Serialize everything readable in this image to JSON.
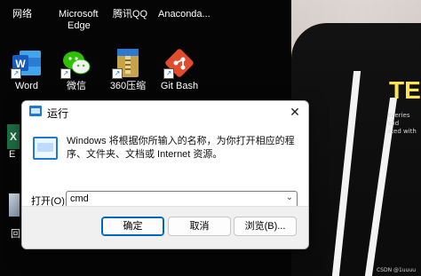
{
  "desktop": {
    "icons": [
      {
        "label": "网络",
        "icon": "network-icon"
      },
      {
        "label": "Microsoft Edge",
        "line1": "Microsoft",
        "line2": "Edge",
        "icon": "edge-icon"
      },
      {
        "label": "腾讯QQ",
        "icon": "qq-icon"
      },
      {
        "label": "Anaconda...",
        "icon": "anaconda-icon"
      },
      {
        "label": "Word",
        "icon": "word-icon"
      },
      {
        "label": "微信",
        "icon": "wechat-icon"
      },
      {
        "label": "360压缩",
        "icon": "zip-icon"
      },
      {
        "label": "Git Bash",
        "icon": "git-bash-icon"
      },
      {
        "label": "E",
        "icon": "excel-icon"
      },
      {
        "label": "回",
        "icon": "recycle-bin-icon"
      }
    ],
    "wallpaper": {
      "text": "TERI",
      "subtext_line1": "overies and",
      "subtext_line2": "ated with",
      "watermark": "CSDN @1uuuu"
    }
  },
  "run_dialog": {
    "title": "运行",
    "close_glyph": "✕",
    "description": "Windows 将根据你所输入的名称，为你打开相应的程序、文件夹、文档或 Internet 资源。",
    "open_label": "打开(O):",
    "input_value": "cmd",
    "caret_glyph": "⌄",
    "ok_label": "确定",
    "cancel_label": "取消",
    "browse_label": "浏览(B)...",
    "accent": "#0067c0"
  }
}
